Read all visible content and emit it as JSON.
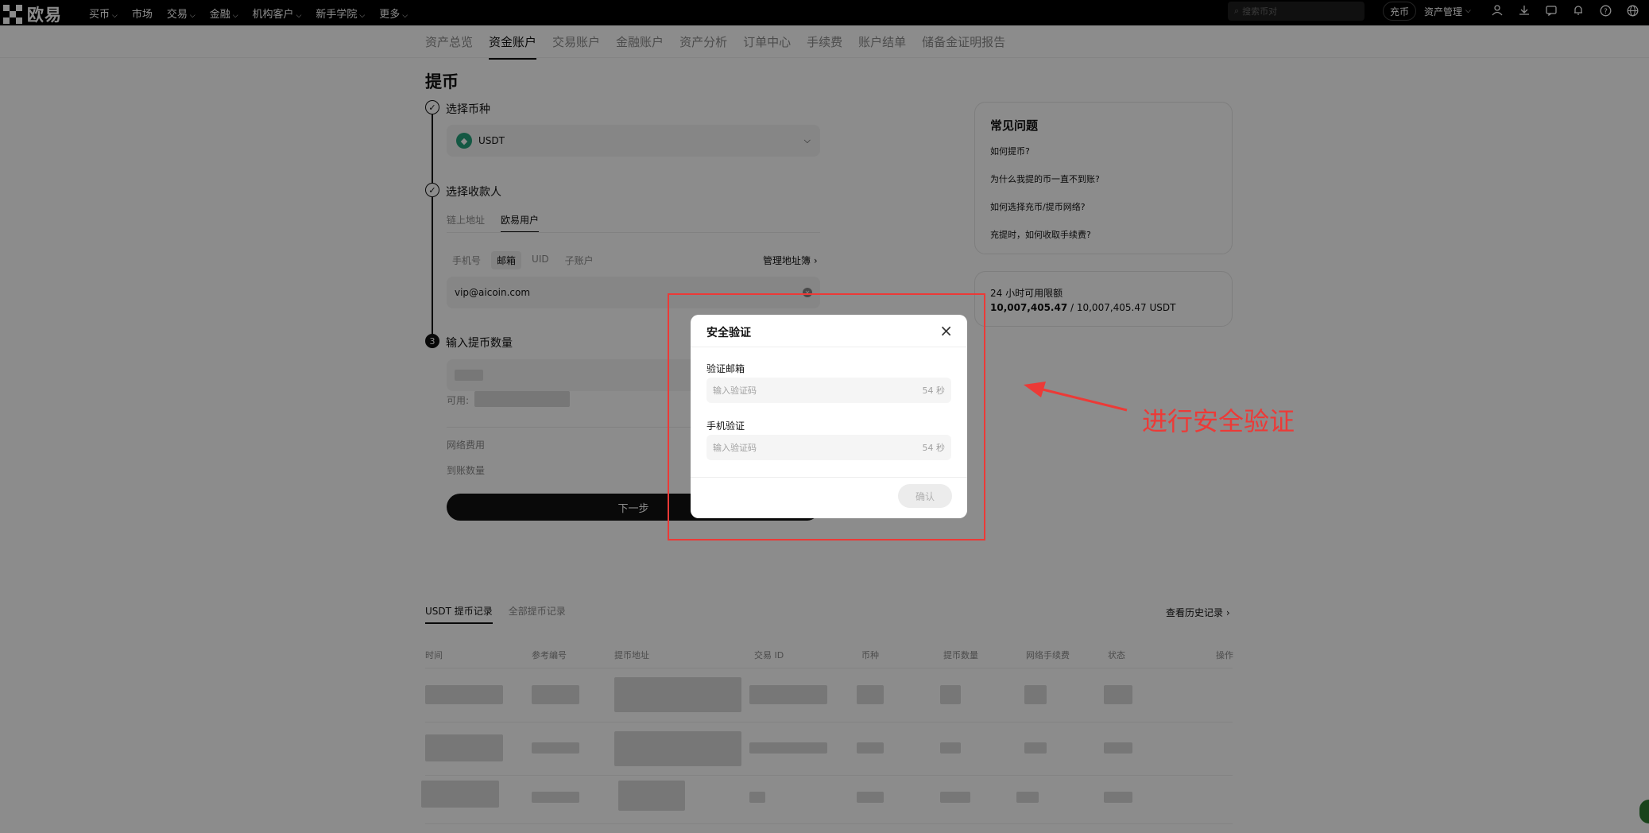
{
  "app": {
    "logo_text": "欧易",
    "nav": [
      "买币",
      "市场",
      "交易",
      "金融",
      "机构客户",
      "新手学院",
      "更多"
    ],
    "nav_has_caret": [
      true,
      false,
      true,
      true,
      true,
      true,
      true
    ],
    "search_placeholder": "搜索币对",
    "deposit_label": "充币",
    "asset_mgmt_label": "资产管理",
    "icons": [
      "user-icon",
      "download-icon",
      "message-icon",
      "bell-icon",
      "help-icon",
      "globe-icon"
    ]
  },
  "subnav": [
    "资产总览",
    "资金账户",
    "交易账户",
    "金融账户",
    "资产分析",
    "订单中心",
    "手续费",
    "账户结单",
    "储备金证明报告"
  ],
  "subnav_active": 1,
  "page_title": "提币",
  "steps": {
    "step1_label": "选择币种",
    "coin": "USDT",
    "step2_label": "选择收款人",
    "recv_tabs": [
      "链上地址",
      "欧易用户"
    ],
    "recv_active": 1,
    "id_tabs": [
      "手机号",
      "邮箱",
      "UID",
      "子账户"
    ],
    "id_active": 1,
    "address_book": "管理地址簿",
    "email_value": "vip@aicoin.com",
    "step3_number": "3",
    "step3_label": "输入提币数量",
    "available_label": "可用:",
    "network_fee_label": "网络费用",
    "receive_amount_label": "到账数量",
    "next_label": "下一步"
  },
  "faq": {
    "title": "常见问题",
    "items": [
      "如何提币?",
      "为什么我提的币一直不到账?",
      "如何选择充币/提币网络?",
      "充提时，如何收取手续费?"
    ]
  },
  "limit": {
    "label": "24 小时可用限额",
    "used": "10,007,405.47",
    "separator": " / ",
    "total": "10,007,405.47 USDT"
  },
  "history": {
    "tabs": [
      "USDT 提币记录",
      "全部提币记录"
    ],
    "active": 0,
    "more": "查看历史记录",
    "columns": [
      "时间",
      "参考编号",
      "提币地址",
      "交易 ID",
      "币种",
      "提币数量",
      "网络手续费",
      "状态",
      "操作"
    ]
  },
  "modal": {
    "title": "安全验证",
    "email_label": "验证邮箱",
    "email_placeholder": "输入验证码",
    "email_timer": "54 秒",
    "phone_label": "手机验证",
    "phone_placeholder": "输入验证码",
    "phone_timer": "54 秒",
    "confirm_label": "确认"
  },
  "annotation": {
    "text": "进行安全验证",
    "color": "#ec3a37"
  }
}
